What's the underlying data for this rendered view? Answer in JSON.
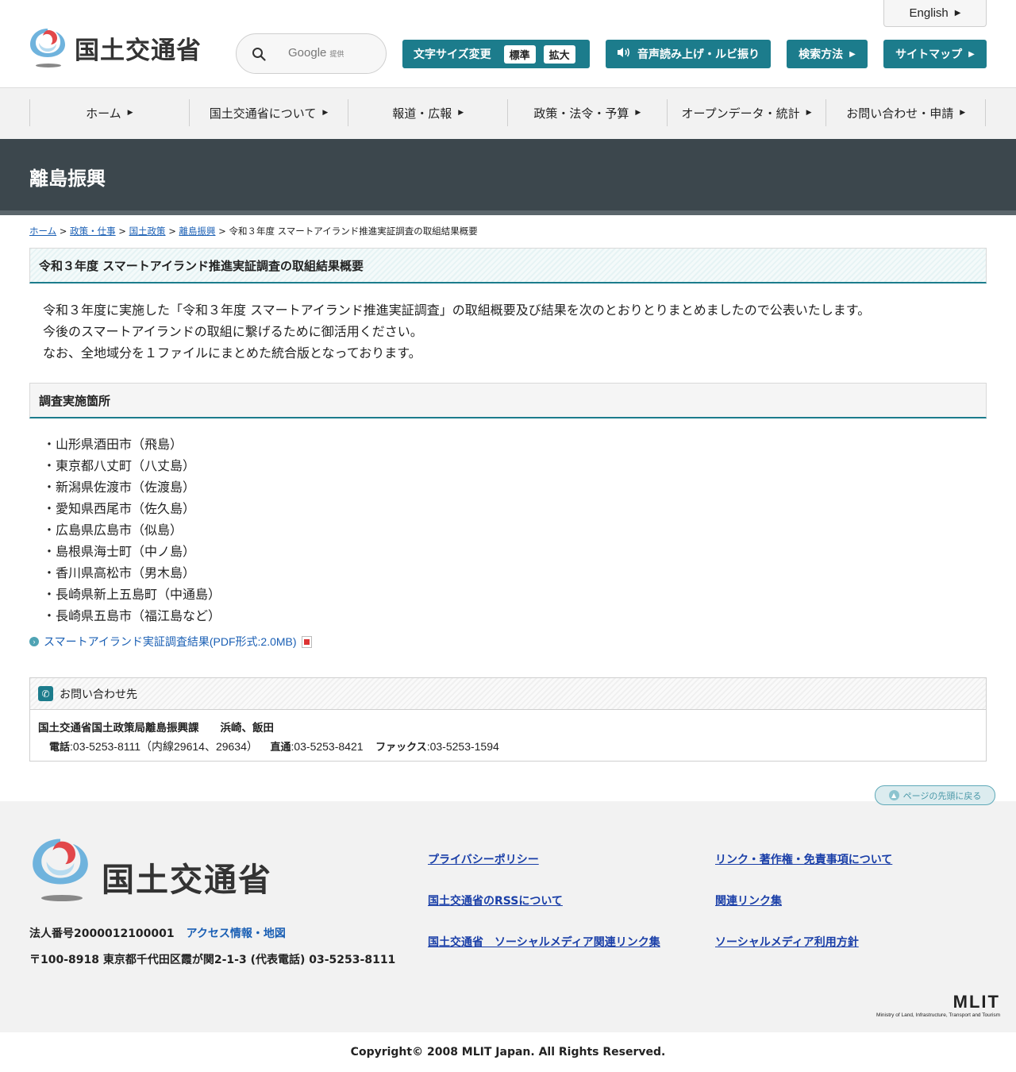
{
  "header": {
    "logo_text": "国土交通省",
    "search": {
      "placeholder": "Google 提供",
      "brand": "Google",
      "brand_note": "提供"
    },
    "english": "English",
    "font_size": {
      "label": "文字サイズ変更",
      "standard": "標準",
      "large": "拡大"
    },
    "voice": "音声読み上げ・ルビ振り",
    "search_method": "検索方法",
    "sitemap": "サイトマップ"
  },
  "gnav": {
    "items": [
      {
        "label": "ホーム"
      },
      {
        "label": "国土交通省について"
      },
      {
        "label": "報道・広報"
      },
      {
        "label": "政策・法令・予算"
      },
      {
        "label": "オープンデータ・統計"
      },
      {
        "label": "お問い合わせ・申請"
      }
    ]
  },
  "page": {
    "section_title": "離島振興",
    "breadcrumb": [
      "ホーム",
      "政策・仕事",
      "国土政策",
      "離島振興",
      "令和３年度 スマートアイランド推進実証調査の取組結果概要"
    ],
    "title": "令和３年度 スマートアイランド推進実証調査の取組結果概要",
    "intro": [
      "令和３年度に実施した「令和３年度 スマートアイランド推進実証調査」の取組概要及び結果を次のとおりとりまとめましたので公表いたします。",
      "今後のスマートアイランドの取組に繋げるために御活用ください。",
      "なお、全地域分を１ファイルにまとめた統合版となっております。"
    ],
    "sites_heading": "調査実施箇所",
    "sites": [
      "・山形県酒田市（飛島）",
      "・東京都八丈町（八丈島）",
      "・新潟県佐渡市（佐渡島）",
      "・愛知県西尾市（佐久島）",
      "・広島県広島市（似島）",
      "・島根県海士町（中ノ島）",
      "・香川県高松市（男木島）",
      "・長崎県新上五島町（中通島）",
      "・長崎県五島市（福江島など）"
    ],
    "pdf_link": "スマートアイランド実証調査結果(PDF形式:2.0MB)"
  },
  "contact": {
    "heading": "お問い合わせ先",
    "org": "国土交通省国土政策局離島振興課　　浜崎、飯田",
    "tel_label": "電話",
    "tel": ":03-5253-8111（内線29614、29634）",
    "direct_label": "直通",
    "direct": ":03-5253-8421",
    "fax_label": "ファックス",
    "fax": ":03-5253-1594"
  },
  "page_top": "ページの先頭に戻る",
  "footer": {
    "logo_text": "国土交通省",
    "corp_number": "法人番号2000012100001",
    "access": "アクセス情報・地図",
    "address": "〒100-8918 東京都千代田区霞が関2-1-3 (代表電話) 03-5253-8111",
    "links": [
      "プライバシーポリシー",
      "リンク・著作権・免責事項について",
      "国土交通省のRSSについて",
      "関連リンク集",
      "国土交通省　ソーシャルメディア関連リンク集",
      "ソーシャルメディア利用方針"
    ],
    "mlit": "MLIT",
    "mlit_full": "Ministry of Land, Infrastructure, Transport and Tourism",
    "copyright": "Copyright© 2008 MLIT Japan. All Rights Reserved."
  },
  "colors": {
    "accent": "#1c7c8c",
    "title_band": "#3c474d",
    "link": "#1a5fb4"
  }
}
